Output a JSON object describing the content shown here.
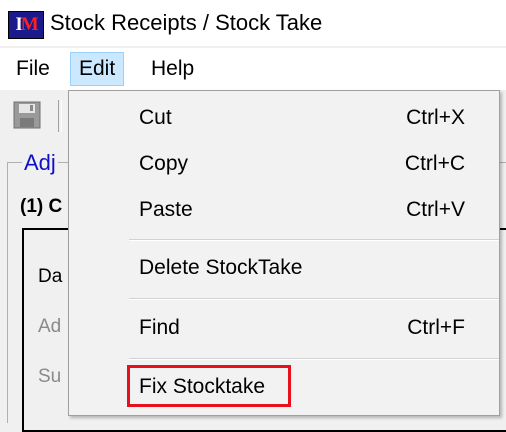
{
  "window": {
    "title": "Stock Receipts / Stock Take",
    "icon_name": "app-logo-icon"
  },
  "menubar": {
    "file": "File",
    "edit": "Edit",
    "help": "Help"
  },
  "toolbar": {
    "save_icon": "save-disk-icon"
  },
  "panel": {
    "title": "Adj",
    "section_label": "(1) C",
    "fields": [
      "Da",
      "Ad",
      "Su"
    ]
  },
  "edit_menu": {
    "items": [
      {
        "label": "Cut",
        "shortcut": "Ctrl+X"
      },
      {
        "label": "Copy",
        "shortcut": "Ctrl+C"
      },
      {
        "label": "Paste",
        "shortcut": "Ctrl+V"
      },
      {
        "label": "Delete StockTake",
        "shortcut": ""
      },
      {
        "label": "Find",
        "shortcut": "Ctrl+F"
      },
      {
        "label": "Fix Stocktake",
        "shortcut": ""
      }
    ],
    "highlight_color": "#e8101c"
  },
  "colors": {
    "menu_active_bg": "#cce8ff",
    "panel_title": "#1010c8"
  }
}
